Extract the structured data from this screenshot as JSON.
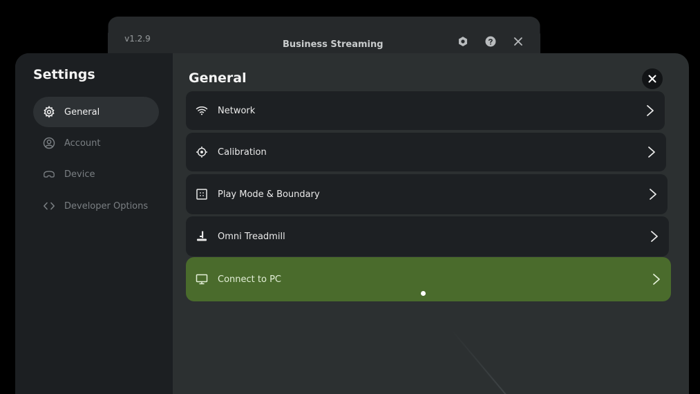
{
  "background_window": {
    "version": "v1.2.9",
    "title": "Business Streaming",
    "icons": [
      "settings-icon",
      "help-icon",
      "close-icon"
    ]
  },
  "settings": {
    "title": "Settings",
    "sidebar": {
      "items": [
        {
          "label": "General",
          "icon": "gear-icon",
          "active": true
        },
        {
          "label": "Account",
          "icon": "account-icon",
          "active": false
        },
        {
          "label": "Device",
          "icon": "headset-icon",
          "active": false
        },
        {
          "label": "Developer Options",
          "icon": "code-icon",
          "active": false
        }
      ]
    },
    "content": {
      "title": "General",
      "rows": [
        {
          "label": "Network",
          "icon": "wifi-icon"
        },
        {
          "label": "Calibration",
          "icon": "crosshair-icon"
        },
        {
          "label": "Play Mode & Boundary",
          "icon": "boundary-icon"
        },
        {
          "label": "Omni Treadmill",
          "icon": "treadmill-icon"
        },
        {
          "label": "Connect to PC",
          "icon": "monitor-icon",
          "highlighted": true
        }
      ]
    }
  },
  "colors": {
    "accent_green": "#4a6b2c",
    "panel": "#2c3031",
    "sidebar": "#1c1f22",
    "row": "#1d2023"
  }
}
